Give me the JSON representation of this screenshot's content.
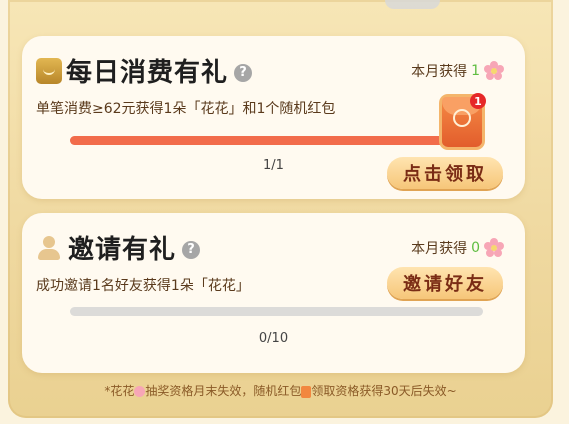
{
  "daily_spend": {
    "title": "每日消费有礼",
    "earned_label": "本月获得",
    "earned_count": "1",
    "description": "单笔消费≥62元获得1朵「花花」和1个随机红包",
    "progress_percent": 100,
    "progress_text": "1/1",
    "badge_count": "1",
    "button_label": "点击领取"
  },
  "invite": {
    "title": "邀请有礼",
    "earned_label": "本月获得",
    "earned_count": "0",
    "description": "成功邀请1名好友获得1朵「花花」",
    "progress_percent": 0,
    "progress_text": "0/10",
    "button_label": "邀请好友"
  },
  "footnote": {
    "part1": "*花花",
    "part2": "抽奖资格月末失效，随机红包",
    "part3": "领取资格获得30天后失效~"
  }
}
